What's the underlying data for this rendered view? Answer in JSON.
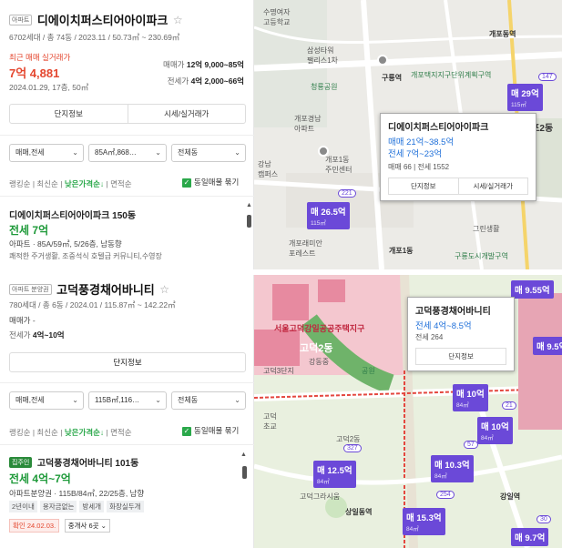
{
  "top": {
    "tag": "아파트",
    "title": "디에이치퍼스티어아이파크",
    "meta": "6702세대 / 총 74동 / 2023.11 / 50.73㎡ ~ 230.69㎡",
    "recent_label": "최근 매매 실거래가",
    "recent_price": "7억 4,881",
    "recent_date": "2024.01.29, 17층, 50㎡",
    "sale_label": "매매가",
    "sale_value": "12억 9,000~85억",
    "rent_label": "전세가",
    "rent_value": "4억 2,000~66억",
    "btn_info": "단지정보",
    "btn_price": "시세/실거래가",
    "sel_type": "매매,전세",
    "sel_area": "85A㎡,868…",
    "sel_dong": "전체동",
    "sorts": [
      "랭킹순",
      "최신순",
      "낮은가격순↓",
      "면적순"
    ],
    "same_label": "동일매물 묶기",
    "listing_title": "디에이치퍼스티어아이파크 150동",
    "listing_price": "전세 7억",
    "listing_desc": "아파트 · 85A/59㎡, 5/26층, 남동향",
    "listing_note": "쾌적한 주거생활, 조중석식 호텔급 커뮤니티,수영장"
  },
  "bottom": {
    "tag": "아파트 분양권",
    "title": "고덕풍경채어바니티",
    "meta": "780세대 / 총 6동 / 2024.01 / 115.87㎡ ~ 142.22㎡",
    "sale_line": "매매가 -",
    "rent_label": "전세가",
    "rent_value": "4억~10억",
    "btn_info": "단지정보",
    "sel_type": "매매,전세",
    "sel_area": "115B㎡,116…",
    "sel_dong": "전체동",
    "sorts": [
      "랭킹순",
      "최신순",
      "낮은가격순↓",
      "면적순"
    ],
    "same_label": "동일매물 묶기",
    "listing_tag": "집주인",
    "listing_title": "고덕풍경채어바니티 101동",
    "listing_price": "전세 4억~7억",
    "listing_desc": "아파트분양권 · 115B/84㎡, 22/25층, 남향",
    "features": [
      "2년이내",
      "용자금없는",
      "방세개",
      "화장실두개"
    ],
    "confirm": "확인 24.02.03.",
    "agent": "중개사 6곳"
  },
  "map1": {
    "labels": [
      "수명여자\n고등학교",
      "개포동역",
      "삼성타워\n팰리스1차",
      "구룡역",
      "개포택지지구단위계획구역",
      "개포1동\n주민센터",
      "개포래미안\n포레스트",
      "개포1동",
      "개포2동",
      "그린생활",
      "구룡도시개발구역",
      "청룡공원",
      "개포경남\n아파트",
      "강남\n캠퍼스"
    ],
    "markers": [
      {
        "price": "매 29억",
        "sub": "115㎡"
      },
      {
        "price": "매 26.5억",
        "sub": "115㎡"
      }
    ],
    "circles": [
      "147",
      "221"
    ],
    "popup": {
      "title": "디에이치퍼스티어아이파크",
      "sale": "매매 21억~38.5억",
      "rent": "전세 7억~23억",
      "counts": "매매 66 | 전세 1552",
      "btn1": "단지정보",
      "btn2": "시세/실거래가"
    }
  },
  "map2": {
    "labels": [
      "서울고덕강일공공주택지구",
      "고덕2동",
      "고덕2동",
      "고덕\n초교",
      "고덕그라시움",
      "상일동역",
      "강일역",
      "고덕3단지",
      "강동중",
      "공원"
    ],
    "markers": [
      {
        "price": "매 10억",
        "sub": "84㎡"
      },
      {
        "price": "매 10억",
        "sub": "84㎡"
      },
      {
        "price": "매 12.5억",
        "sub": "84㎡"
      },
      {
        "price": "매 10.3억",
        "sub": "84㎡"
      },
      {
        "price": "매 15.3억",
        "sub": "84㎡"
      },
      {
        "price": "매 9.55억",
        "sub": ""
      },
      {
        "price": "매 9.5억",
        "sub": ""
      },
      {
        "price": "매 9.7억",
        "sub": ""
      }
    ],
    "circles": [
      "327",
      "57",
      "254",
      "21",
      "30"
    ],
    "popup": {
      "title": "고덕풍경채어바니티",
      "sale": "전세 4억~8.5억",
      "rent": "전세 264",
      "btn1": "단지정보"
    }
  },
  "colors": {
    "accent_red": "#e4472f",
    "accent_green": "#2aa84a",
    "marker": "#6b49d8",
    "popup_blue": "#1e6fd9"
  }
}
